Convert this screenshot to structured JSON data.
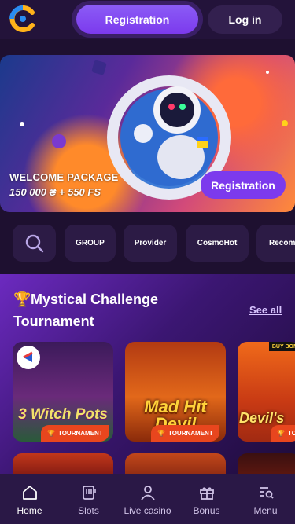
{
  "header": {
    "registration_label": "Registration",
    "login_label": "Log in"
  },
  "hero": {
    "title": "WELCOME PACKAGE",
    "subtitle": "150 000 ₴ + 550 FS",
    "cta_label": "Registration"
  },
  "filters": {
    "items": [
      "GROUP",
      "Provider",
      "CosmoHot",
      "Recom"
    ]
  },
  "tournament": {
    "title_line1": "Mystical Challenge",
    "title_line2": "Tournament",
    "see_all_label": "See all",
    "games": [
      {
        "name": "3 Witch Pots",
        "tag": "TOURNAMENT"
      },
      {
        "name": "Mad Hit Devil",
        "tag": "TOURNAMENT"
      },
      {
        "name": "Devil's",
        "tag": "TO"
      }
    ],
    "buy_badge": "BUY BON"
  },
  "nav": {
    "items": [
      {
        "label": "Home",
        "active": true
      },
      {
        "label": "Slots"
      },
      {
        "label": "Live casino"
      },
      {
        "label": "Bonus"
      },
      {
        "label": "Menu"
      }
    ]
  },
  "colors": {
    "accent": "#7c3aed",
    "background": "#1e1030",
    "tag": "#e8461e"
  }
}
